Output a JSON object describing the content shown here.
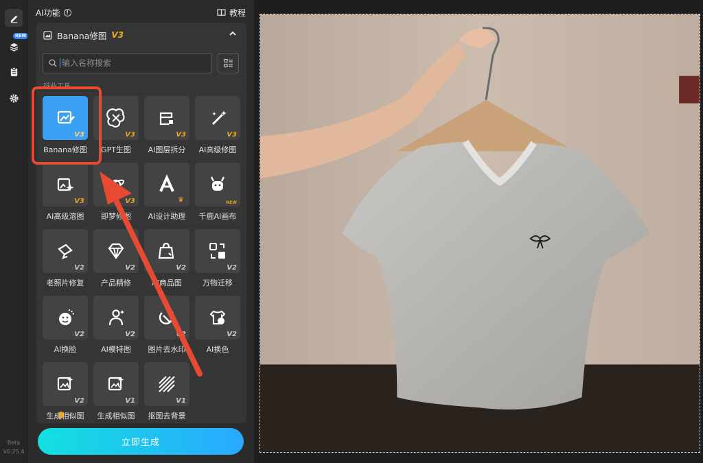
{
  "rail": {
    "new_badge": "NEW",
    "version_beta": "Beta",
    "version_number": "V0.25.4"
  },
  "panel": {
    "header_title": "AI功能",
    "tutorial_label": "教程",
    "card_title": "Banana修图",
    "card_version": "V3",
    "search_placeholder": "输入名称搜索",
    "section_label": "行业工具",
    "tools": [
      {
        "label": "Banana修图",
        "version": "V3",
        "icon": "image-edit-icon",
        "selected": true
      },
      {
        "label": "GPT生图",
        "version": "V3",
        "icon": "gpt-knot-icon"
      },
      {
        "label": "AI图层拆分",
        "version": "V3",
        "icon": "layers-split-icon"
      },
      {
        "label": "AI高级修图",
        "version": "V3",
        "icon": "magic-wand-icon"
      },
      {
        "label": "AI高级溶图",
        "version": "V3",
        "icon": "image-sparkle-icon"
      },
      {
        "label": "即梦修图",
        "version": "V3",
        "icon": "dream-planet-icon"
      },
      {
        "label": "AI设计助理",
        "version": "",
        "icon": "design-a-icon",
        "crown": true
      },
      {
        "label": "千鹿AI画布",
        "version": "NEW",
        "icon": "deer-icon"
      },
      {
        "label": "老照片修复",
        "version": "V2",
        "icon": "photo-restore-icon"
      },
      {
        "label": "产品精修",
        "version": "V2",
        "icon": "diamond-icon"
      },
      {
        "label": "AI商品图",
        "version": "V2",
        "icon": "shopping-bag-icon"
      },
      {
        "label": "万物迁移",
        "version": "V2",
        "icon": "transfer-icon"
      },
      {
        "label": "AI换脸",
        "version": "V2",
        "icon": "face-swap-icon"
      },
      {
        "label": "AI模特图",
        "version": "V2",
        "icon": "model-icon"
      },
      {
        "label": "图片去水印",
        "version": "V2",
        "icon": "watermark-remove-icon"
      },
      {
        "label": "AI换色",
        "version": "V2",
        "icon": "shirt-color-icon"
      },
      {
        "label": "生成相似图",
        "version": "V2",
        "icon": "similar-image-icon"
      },
      {
        "label": "生成相似图",
        "version": "V1",
        "icon": "similar-image-icon-2"
      },
      {
        "label": "抠图去背景",
        "version": "V1",
        "icon": "remove-bg-icon"
      }
    ],
    "generate_label": "立即生成"
  },
  "colors": {
    "accent": "#3aa0f3",
    "version_tag": "#e8a21f",
    "highlight": "#e64a33",
    "generate_start": "#13e0e0",
    "generate_end": "#2aa8ff"
  }
}
